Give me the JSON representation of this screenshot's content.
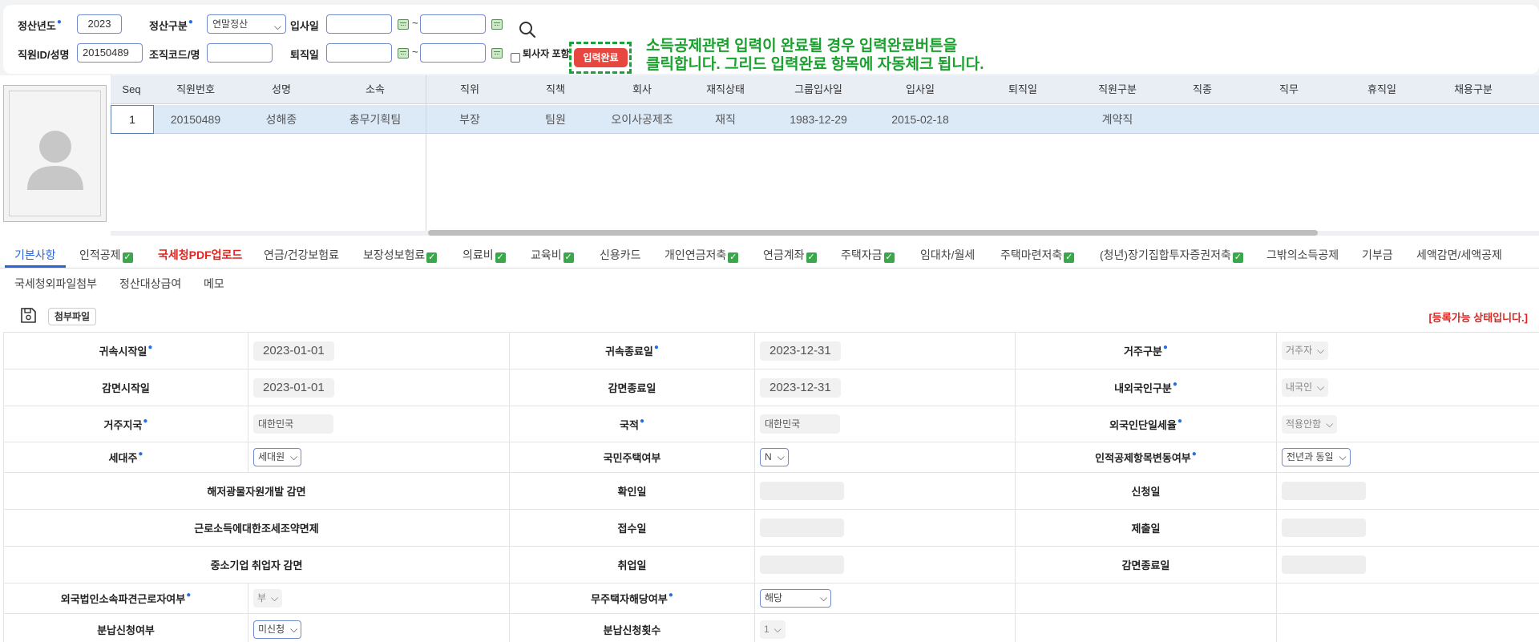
{
  "search": {
    "year_label": "정산년도",
    "year_value": "2023",
    "type_label": "정산구분",
    "type_value": "연말정산",
    "hire_label": "입사일",
    "emp_label": "직원ID/성명",
    "emp_value": "20150489",
    "org_label": "조직코드/명",
    "retire_label": "퇴직일",
    "include_retired_label": "퇴사자 포함",
    "complete_button": "입력완료",
    "notice_line1": "소득공제관련 입력이 완료될 경우 입력완료버튼을",
    "notice_line2": "클릭합니다. 그리드 입력완료 항목에 자동체크 됩니다."
  },
  "grid": {
    "columns": [
      "Seq",
      "직원번호",
      "성명",
      "소속",
      "직위",
      "직책",
      "회사",
      "재직상태",
      "그룹입사일",
      "입사일",
      "퇴직일",
      "직원구분",
      "직종",
      "직무",
      "휴직일",
      "채용구분"
    ],
    "rows": [
      [
        "1",
        "20150489",
        "성해종",
        "총무기획팀",
        "부장",
        "팀원",
        "오이사공제조",
        "재직",
        "1983-12-29",
        "2015-02-18",
        "",
        "계약직",
        "",
        "",
        "",
        ""
      ]
    ]
  },
  "tabs": [
    {
      "label": "기본사항",
      "checked": false
    },
    {
      "label": "인적공제",
      "checked": true
    },
    {
      "label": "국세청PDF업로드",
      "checked": false
    },
    {
      "label": "연금/건강보험료",
      "checked": false
    },
    {
      "label": "보장성보험료",
      "checked": true
    },
    {
      "label": "의료비",
      "checked": true
    },
    {
      "label": "교육비",
      "checked": true
    },
    {
      "label": "신용카드",
      "checked": false
    },
    {
      "label": "개인연금저축",
      "checked": true
    },
    {
      "label": "연금계좌",
      "checked": true
    },
    {
      "label": "주택자금",
      "checked": true
    },
    {
      "label": "임대차/월세",
      "checked": false
    },
    {
      "label": "주택마련저축",
      "checked": true
    },
    {
      "label": "(청년)장기집합투자증권저축",
      "checked": true
    },
    {
      "label": "그밖의소득공제",
      "checked": false
    },
    {
      "label": "기부금",
      "checked": false
    },
    {
      "label": "세액감면/세액공제",
      "checked": false
    },
    {
      "label": "국세청외파일첨부",
      "checked": false
    },
    {
      "label": "정산대상급여",
      "checked": false
    },
    {
      "label": "메모",
      "checked": false
    }
  ],
  "toolbar": {
    "attach_label": "첨부파일",
    "status": "[등록가능 상태입니다.]"
  },
  "form": {
    "attr_start_label": "귀속시작일",
    "attr_start": "2023-01-01",
    "attr_end_label": "귀속종료일",
    "attr_end": "2023-12-31",
    "residence_type_label": "거주구분",
    "residence_type": "거주자",
    "reduce_start_label": "감면시작일",
    "reduce_start": "2023-01-01",
    "reduce_end_label": "감면종료일",
    "reduce_end": "2023-12-31",
    "nationality_type_label": "내외국인구분",
    "nationality_type": "내국인",
    "residence_country_label": "거주지국",
    "residence_country": "대한민국",
    "nationality_label": "국적",
    "nationality": "대한민국",
    "flat_tax_label": "외국인단일세율",
    "flat_tax": "적용안함",
    "householder_label": "세대주",
    "householder": "세대원",
    "national_housing_label": "국민주택여부",
    "national_housing": "N",
    "deduction_change_label": "인적공제항목변동여부",
    "deduction_change": "전년과 동일",
    "overseas_mineral_label": "해저광물자원개발 감면",
    "confirm_date_label": "확인일",
    "apply_date_label": "신청일",
    "treaty_label": "근로소득에대한조세조약면제",
    "receipt_date_label": "접수일",
    "submit_date_label": "제출일",
    "sme_label": "중소기업 취업자 감면",
    "employ_date_label": "취업일",
    "reduce_end_date_label": "감면종료일",
    "foreign_dispatch_label": "외국법인소속파견근로자여부",
    "foreign_dispatch": "부",
    "homeless_label": "무주택자해당여부",
    "homeless": "해당",
    "installment_label": "분납신청여부",
    "installment": "미신청",
    "installment_count_label": "분납신청횟수",
    "installment_count": "1"
  }
}
